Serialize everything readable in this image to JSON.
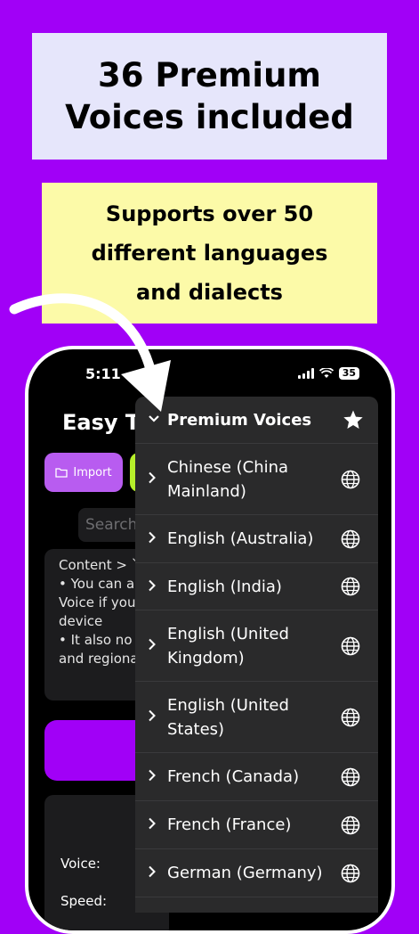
{
  "banners": {
    "headline_line1": "36 Premium",
    "headline_line2": "Voices included",
    "sub_line1": "Supports over 50",
    "sub_line2": "different languages",
    "sub_line3": "and dialects"
  },
  "colors": {
    "background": "#a100f7",
    "headline_bg": "#e6e6fb",
    "sub_bg": "#fcfaa8",
    "import_button": "#b85cf0",
    "accent_green": "#b6ef2a"
  },
  "status_bar": {
    "time": "5:11",
    "battery": "35"
  },
  "app": {
    "title": "Easy Te",
    "import_label": "Import",
    "search_placeholder": "Search",
    "content_lines": [
      "Content > `",
      "• You can a",
      "Voice if you",
      "device",
      "• It also no",
      "and regiona"
    ],
    "voice_label": "Voice:",
    "speed_label": "Speed:"
  },
  "dropdown": {
    "header": "Premium Voices",
    "header_icon": "star-icon",
    "item_icon": "globe-icon",
    "items": [
      {
        "label": "Chinese (China Mainland)"
      },
      {
        "label": "English (Australia)"
      },
      {
        "label": "English (India)"
      },
      {
        "label": "English (United Kingdom)"
      },
      {
        "label": "English (United States)"
      },
      {
        "label": "French (Canada)"
      },
      {
        "label": "French (France)"
      },
      {
        "label": "German (Germany)"
      }
    ]
  }
}
